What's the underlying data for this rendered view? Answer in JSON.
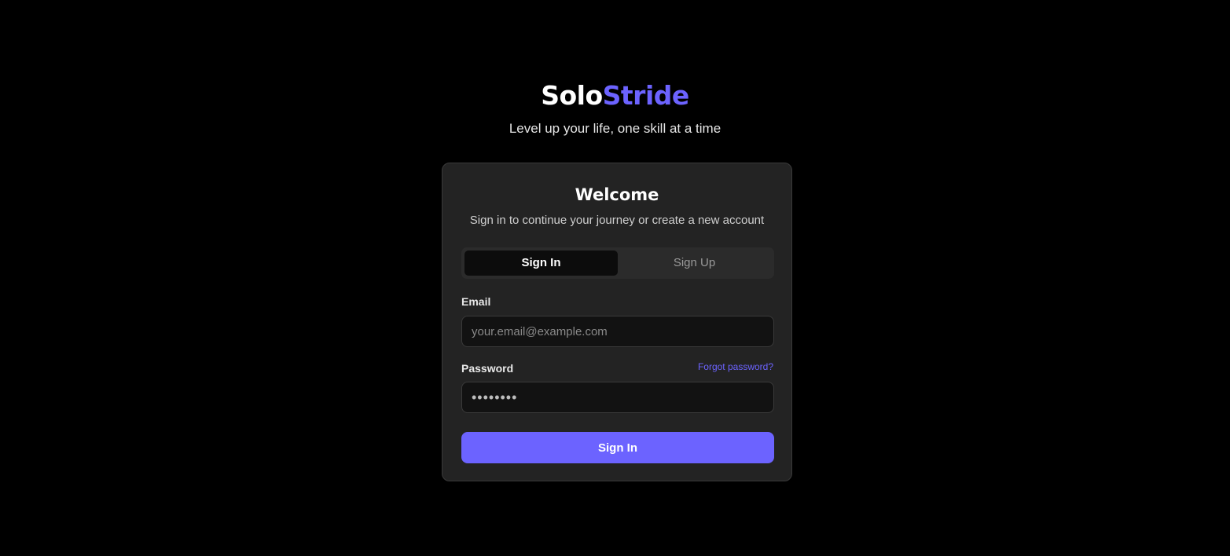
{
  "brand": {
    "part1": "Solo",
    "part2": "Stride",
    "tagline": "Level up your life, one skill at a time"
  },
  "card": {
    "title": "Welcome",
    "subtitle": "Sign in to continue your journey or create a new account"
  },
  "tabs": [
    {
      "label": "Sign In",
      "active": true
    },
    {
      "label": "Sign Up",
      "active": false
    }
  ],
  "form": {
    "email_label": "Email",
    "email_placeholder": "your.email@example.com",
    "email_value": "",
    "password_label": "Password",
    "password_value": "••••••••",
    "forgot_label": "Forgot password?",
    "submit_label": "Sign In"
  },
  "colors": {
    "accent": "#6c63ff",
    "background": "#000000",
    "card": "#232323"
  }
}
